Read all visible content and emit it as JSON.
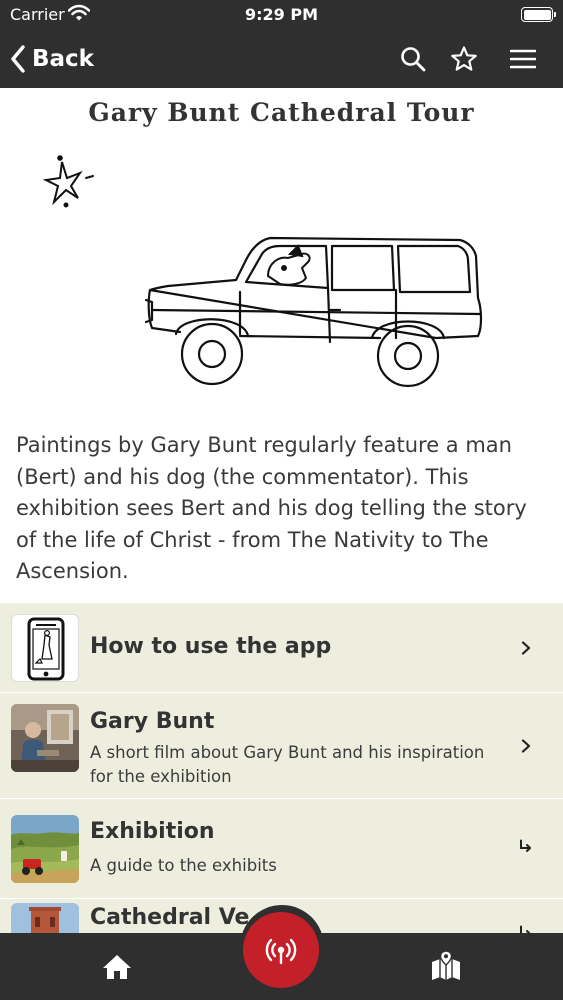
{
  "status": {
    "carrier": "Carrier",
    "time": "9:29 PM"
  },
  "nav": {
    "back_label": "Back",
    "icons": [
      "search-icon",
      "star-icon",
      "menu-icon"
    ]
  },
  "page": {
    "title": "Gary Bunt Cathedral Tour",
    "intro": "Paintings by Gary Bunt regularly feature a man (Bert) and his dog (the commentator). This exhibition sees Bert and his dog telling the story of the life of Christ - from The Nativity to The Ascension."
  },
  "list": [
    {
      "title": "How to use the app",
      "subtitle": "",
      "icon": "chevron-right-icon"
    },
    {
      "title": "Gary Bunt",
      "subtitle": "A short film about Gary Bunt and his inspiration for the exhibition",
      "icon": "chevron-right-icon"
    },
    {
      "title": "Exhibition",
      "subtitle": "A guide to the exhibits",
      "icon": "subdirectory-arrow-icon"
    },
    {
      "title": "Cathedral Ve",
      "subtitle": "",
      "icon": "subdirectory-arrow-icon"
    }
  ],
  "tabs": {
    "icons": [
      "home-icon",
      "audio-broadcast-icon",
      "map-icon"
    ]
  },
  "colors": {
    "bar": "#2f2f2f",
    "list_bg": "#eeeede",
    "accent": "#c3202a"
  }
}
